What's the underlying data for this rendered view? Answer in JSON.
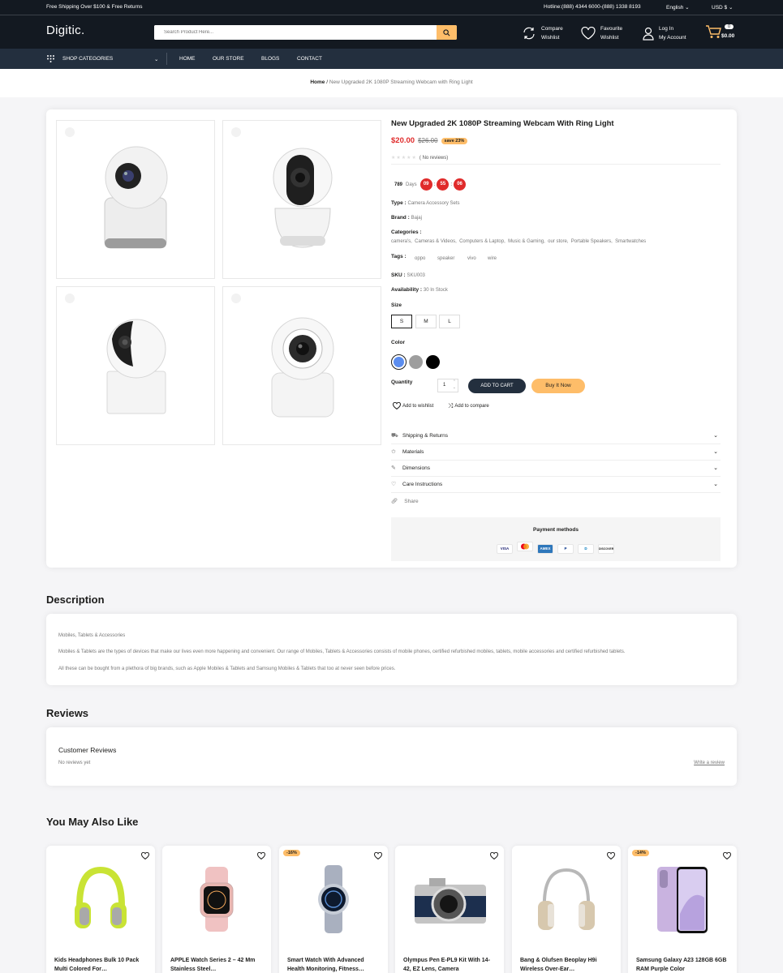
{
  "topbar": {
    "shipping": "Free Shipping Over $100 & Free Returns",
    "hotline": "Hotline:(888) 4344 6000-(888) 1338 8193",
    "language": "English",
    "currency": "USD $"
  },
  "header": {
    "logo": "Digitic.",
    "search_placeholder": "Search Product Here...",
    "compare_l1": "Compare",
    "compare_l2": "Wishlist",
    "fav_l1": "Favourite",
    "fav_l2": "Wishlist",
    "login_l1": "Log In",
    "login_l2": "My Account",
    "cart_count": "0",
    "cart_total": "$0.00"
  },
  "nav": {
    "categories": "SHOP CATEGORIES",
    "links": [
      "HOME",
      "OUR STORE",
      "BLOGS",
      "CONTACT"
    ]
  },
  "breadcrumb": {
    "home": "Home",
    "sep": "/",
    "current": "New Upgraded 2K 1080P Streaming Webcam with Ring Light"
  },
  "product": {
    "title": "New Upgraded 2K 1080P Streaming Webcam With Ring Light",
    "price": "$20.00",
    "old_price": "$26.00",
    "save": "save 23%",
    "reviews": "( No reviews)",
    "rating": 0,
    "countdown": {
      "days": "789",
      "days_label": "Days",
      "h": "09",
      "m": "55",
      "s": "06",
      "sep": ":"
    },
    "type_label": "Type :",
    "type": "Camera Accessory Sets",
    "brand_label": "Brand :",
    "brand": "Bajaj",
    "categories_label": "Categories :",
    "categories": "camera's,  Cameras & Videos,  Computers & Laptop,  Music & Gaming,  our store,  Portable Speakers,  Smartwatches",
    "tags_label": "Tags :",
    "tags": [
      "oppo",
      "speaker",
      "vivo",
      "wire"
    ],
    "sku_label": "SKU :",
    "sku": "SKU003",
    "avail_label": "Availability :",
    "avail": "30 In Stock",
    "size_label": "Size",
    "sizes": [
      "S",
      "M",
      "L"
    ],
    "color_label": "Color",
    "colors": [
      "#5b8def",
      "#9e9e9e",
      "#000000"
    ],
    "qty_label": "Quantity",
    "qty": "1",
    "add_cart": "ADD TO CART",
    "buy_now": "Buy It Now",
    "wishlist": "Add to wishlist",
    "compare": "Add to compare",
    "accordion": [
      "Shipping & Returns",
      "Materials",
      "Dimensions",
      "Care Instructions"
    ],
    "share": "Share",
    "payment_title": "Payment methods",
    "payments": [
      "VISA",
      "MC",
      "AMEX",
      "P",
      "D",
      "DISCOVER"
    ]
  },
  "description": {
    "title": "Description",
    "line1": "Mobiles, Tablets & Accessories",
    "line2": "Mobiles & Tablets are the types of devices that make our lives even more happening and convenient. Our range of Mobiles, Tablets & Accessories consists of mobile phones, certified refurbished mobiles, tablets, mobile accessories and certified refurbished tablets.",
    "line3": "All these can be bought from a plethora of big brands, such as Apple Mobiles & Tablets and Samsung Mobiles & Tablets that too at never seen before prices."
  },
  "reviews": {
    "title": "Reviews",
    "heading": "Customer Reviews",
    "none": "No reviews yet",
    "write": "Write a review"
  },
  "related": {
    "title": "You May Also Like",
    "items": [
      {
        "name": "Kids Headphones Bulk 10 Pack Multi Colored For…",
        "discount": ""
      },
      {
        "name": "APPLE Watch Series 2 – 42 Mm Stainless Steel…",
        "discount": ""
      },
      {
        "name": "Smart Watch With Advanced Health Monitoring, Fitness…",
        "discount": "-16%"
      },
      {
        "name": "Olympus Pen E-PL9 Kit With 14-42, EZ Lens, Camera",
        "discount": ""
      },
      {
        "name": "Bang & Olufsen Beoplay H9i Wireless Over-Ear…",
        "discount": ""
      },
      {
        "name": "Samsung Galaxy A23 128GB 6GB RAM Purple Color",
        "discount": "-14%"
      }
    ]
  }
}
